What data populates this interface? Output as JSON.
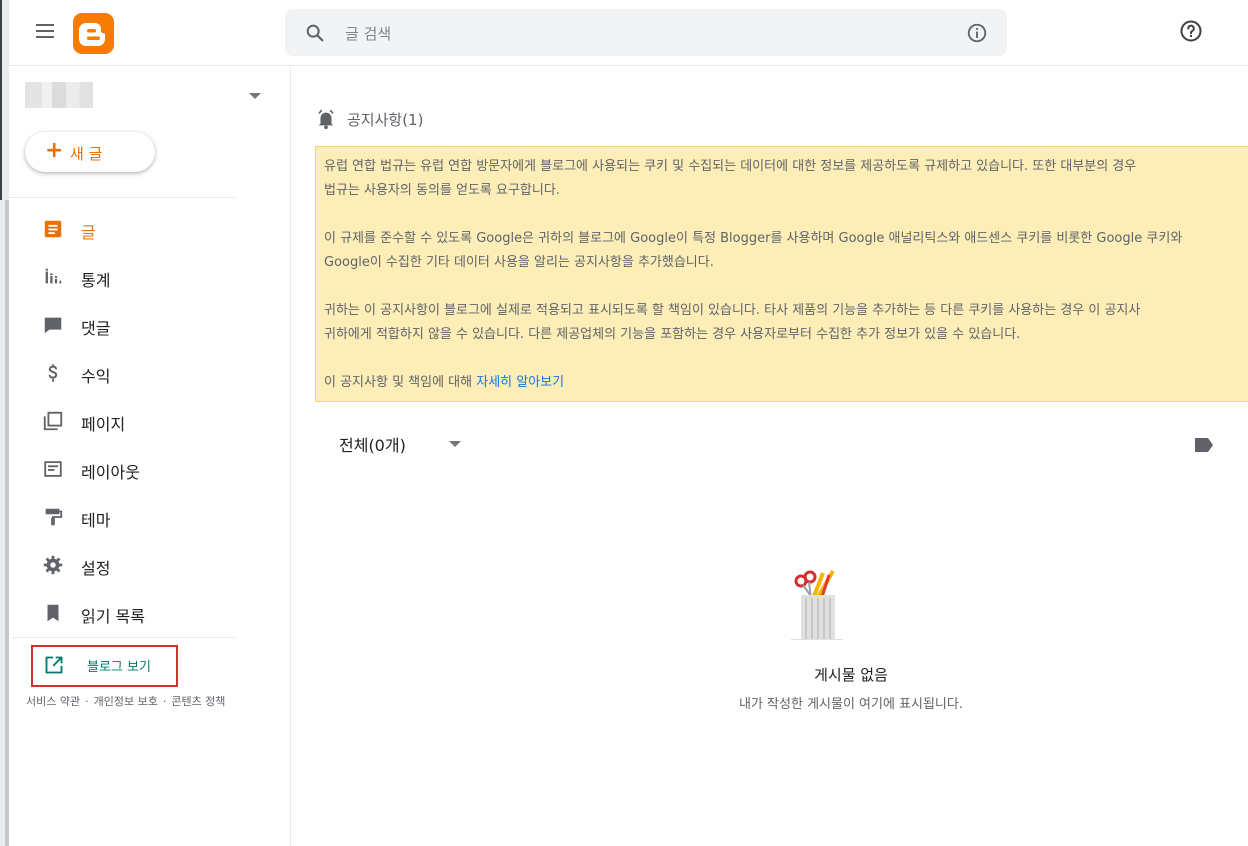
{
  "header": {
    "search": {
      "placeholder": "글 검색"
    }
  },
  "sidebar": {
    "new_post_label": "새 글",
    "nav": [
      {
        "id": "posts",
        "label": "글",
        "icon": "posts-icon",
        "active": true
      },
      {
        "id": "stats",
        "label": "통계",
        "icon": "stats-icon"
      },
      {
        "id": "comments",
        "label": "댓글",
        "icon": "comments-icon"
      },
      {
        "id": "earnings",
        "label": "수익",
        "icon": "dollar-icon"
      },
      {
        "id": "pages",
        "label": "페이지",
        "icon": "pages-icon"
      },
      {
        "id": "layout",
        "label": "레이아웃",
        "icon": "layout-icon"
      },
      {
        "id": "theme",
        "label": "테마",
        "icon": "paint-roller-icon"
      },
      {
        "id": "settings",
        "label": "설정",
        "icon": "gear-icon"
      },
      {
        "id": "reading-list",
        "label": "읽기 목록",
        "icon": "bookmark-icon"
      }
    ],
    "view_blog_label": "블로그 보기",
    "footer": {
      "terms": "서비스 약관",
      "privacy": "개인정보 보호",
      "content_policy": "콘텐츠 정책",
      "separator": "·"
    }
  },
  "main": {
    "notice": {
      "title": "공지사항(1)",
      "paragraphs": [
        [
          "유럽 연합 법규는 유럽 연합 방문자에게 블로그에 사용되는 쿠키 및 수집되는 데이터에 대한 정보를 제공하도록 규제하고 있습니다. 또한 대부분의 경우",
          "법규는 사용자의 동의를 얻도록 요구합니다."
        ],
        [
          "이 규제를 준수할 수 있도록 Google은 귀하의 블로그에 Google이 특정 Blogger를 사용하며 Google 애널리틱스와 애드센스 쿠키를 비롯한 Google 쿠키와",
          "Google이 수집한 기타 데이터 사용을 알리는 공지사항을 추가했습니다."
        ],
        [
          "귀하는 이 공지사항이 블로그에 실제로 적용되고 표시되도록 할 책임이 있습니다. 타사 제품의 기능을 추가하는 등 다른 쿠키를 사용하는 경우 이 공지사",
          "귀하에게 적합하지 않을 수 있습니다. 다른 제공업체의 기능을 포함하는 경우 사용자로부터 수집한 추가 정보가 있을 수 있습니다."
        ]
      ],
      "last_line_text": "이 공지사항 및 책임에 대해 ",
      "learn_more_link": "자세히 알아보기"
    },
    "filter_label": "전체(0개)",
    "empty": {
      "title": "게시물 없음",
      "subtitle": "내가 작성한 게시물이 여기에 표시됩니다."
    }
  },
  "colors": {
    "accent": "#e8710a",
    "logo": "#f57c00",
    "notice_bg": "#fdeeb8",
    "link": "#1a73e8",
    "view_blog": "#00796b",
    "highlight_border": "#d32f2f"
  }
}
